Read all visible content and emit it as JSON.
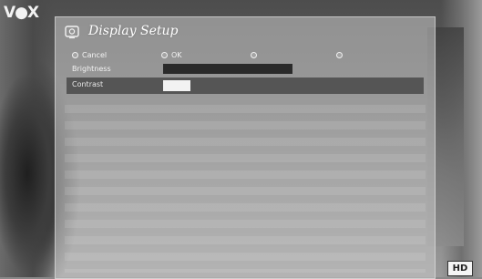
{
  "brand": {
    "logo_text": "V●X"
  },
  "osd": {
    "title": "Display Setup",
    "icon": "display-settings-icon",
    "buttons": [
      {
        "label": "Cancel"
      },
      {
        "label": "OK"
      },
      {
        "label": ""
      },
      {
        "label": ""
      }
    ],
    "settings": [
      {
        "label": "Brightness",
        "level": 1.0
      },
      {
        "label": "Contrast",
        "level": 0.2
      }
    ]
  },
  "badge": {
    "label": "HD"
  }
}
